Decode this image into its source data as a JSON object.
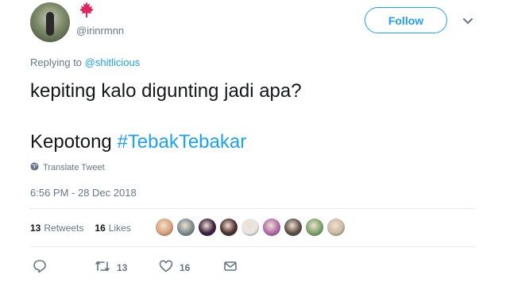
{
  "author": {
    "handle": "@irinrmnn",
    "flag_icon": "canada-flag-icon",
    "follow_label": "Follow"
  },
  "reply": {
    "prefix": "Replying to",
    "mention": "@shitlicious"
  },
  "tweet": {
    "line1": "kepiting kalo digunting jadi apa?",
    "line2_text": "Kepotong",
    "hashtag": "#TebakTebakar"
  },
  "translate_label": "Translate Tweet",
  "timestamp": "6:56 PM - 28 Dec 2018",
  "stats": {
    "retweets_count": "13",
    "retweets_label": "Retweets",
    "likes_count": "16",
    "likes_label": "Likes"
  },
  "likers": [
    {
      "color": "#d8a07a"
    },
    {
      "color": "#7a8a8c"
    },
    {
      "color": "#3a1d3d"
    },
    {
      "color": "#4a2c2c"
    },
    {
      "color": "#e6e6e6"
    },
    {
      "color": "#b06aa8"
    },
    {
      "color": "#5b4e44"
    },
    {
      "color": "#7aa36a"
    },
    {
      "color": "#c9b8a2"
    }
  ],
  "actions": {
    "reply_icon": "reply-icon",
    "retweet_icon": "retweet-icon",
    "retweet_count": "13",
    "like_icon": "heart-icon",
    "like_count": "16",
    "dm_icon": "envelope-icon"
  },
  "colors": {
    "accent": "#1da1f2",
    "muted": "#657786",
    "text": "#14171a"
  }
}
